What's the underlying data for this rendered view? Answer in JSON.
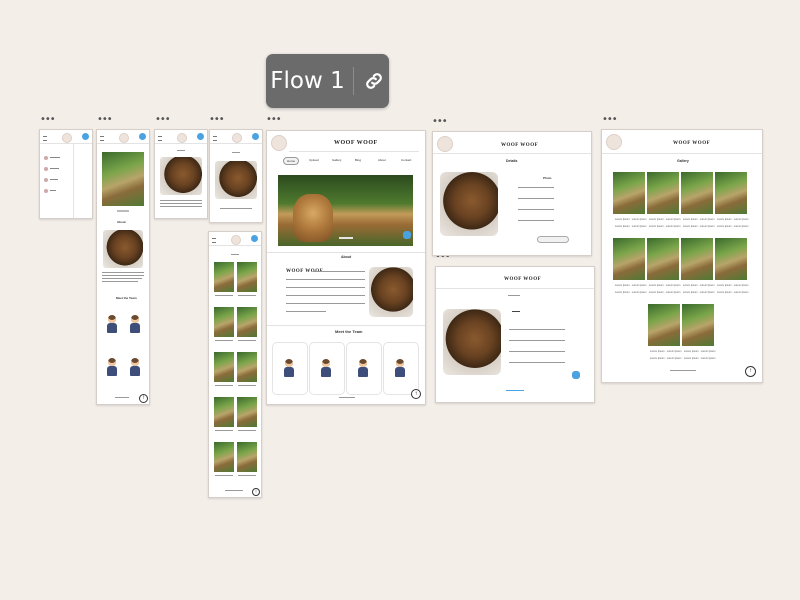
{
  "canvas": {
    "background": "#f4eee9"
  },
  "flow": {
    "label": "Flow 1",
    "link_icon": "link-icon"
  },
  "frame_menu": {
    "dots": "•••"
  },
  "site": {
    "title": "WOOF WOOF",
    "nav": [
      "Home",
      "Upload",
      "Gallery",
      "Blog",
      "About",
      "Contact"
    ],
    "about_heading": "About",
    "about_lead": "WOOF WOOF",
    "meet_heading": "Meet the Team",
    "gallery_heading": "Gallery",
    "photo_heading": "Photo",
    "detail_heading": "Details",
    "detail_lines": [
      "Lorem Ipsum · Lorem Ipsum · Lorem",
      "Lorem Ipsum · Lorem Ipsum · Lorem",
      "Lorem Ipsum · Lorem Ipsum · Lorem",
      "Lorem Ipsum · Lorem Ipsum · Lorem"
    ],
    "cta_button": "Learn more about dogs here",
    "caption": "Lorem Ipsum · Lorem Ipsum",
    "footer": "Woof Woof © Copyright",
    "gallery_footer": "Woof Woof © Photographs",
    "up_arrow": "↑"
  },
  "colors": {
    "accent": "#4aa3e0",
    "frame_border": "#d6cfc9",
    "pill": "#6b6b6b"
  }
}
